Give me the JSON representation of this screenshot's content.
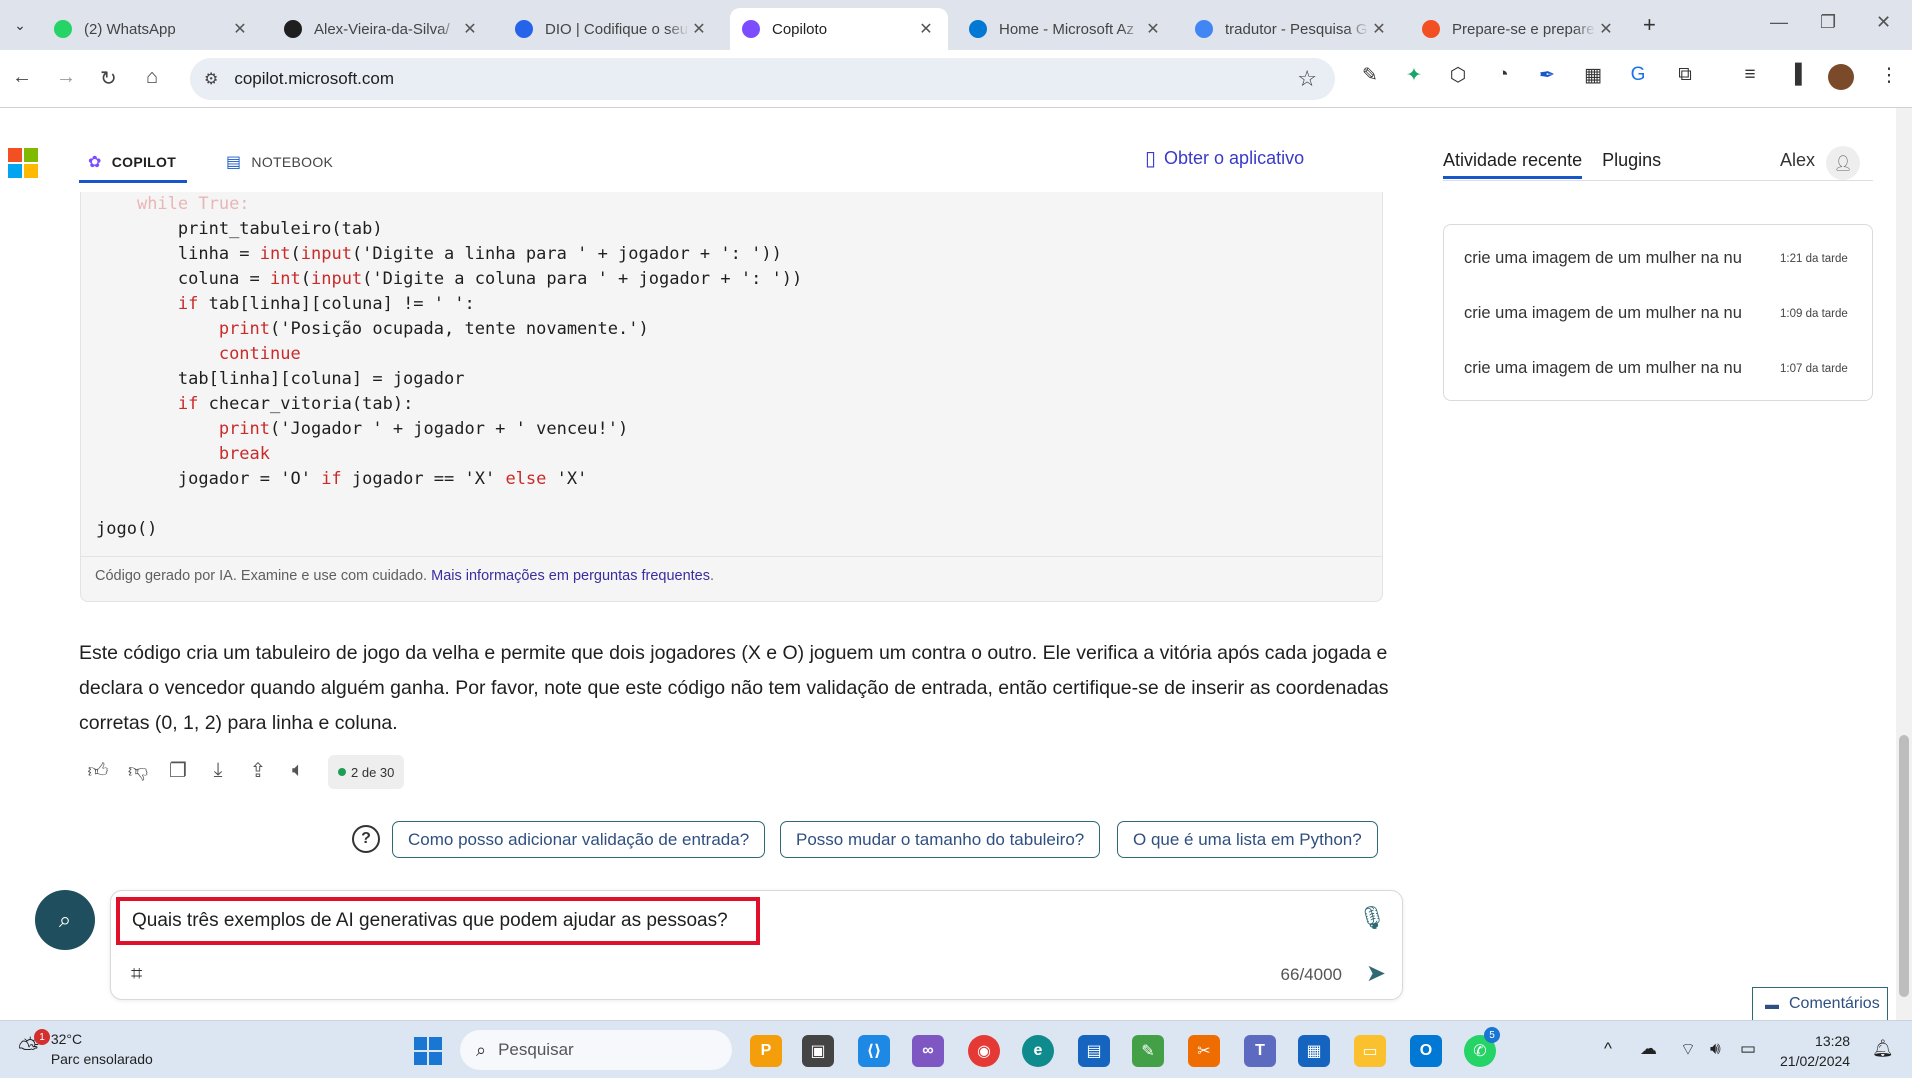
{
  "browser": {
    "tabs": [
      {
        "title": "(2) WhatsApp",
        "icon": "whatsapp-icon",
        "color": "#25d366"
      },
      {
        "title": "Alex-Vieira-da-Silva/",
        "icon": "github-icon",
        "color": "#1f1f1f"
      },
      {
        "title": "DIO | Codifique o seu",
        "icon": "dio-icon",
        "color": "#2563eb"
      },
      {
        "title": "Copiloto",
        "icon": "copilot-icon",
        "color": "#7c4dff"
      },
      {
        "title": "Home - Microsoft Az",
        "icon": "azure-icon",
        "color": "#0078d4"
      },
      {
        "title": "tradutor - Pesquisa G",
        "icon": "google-icon",
        "color": "#4285f4"
      },
      {
        "title": "Prepare-se e prepare",
        "icon": "microsoft-icon",
        "color": "#f25022"
      }
    ],
    "url": "copilot.microsoft.com"
  },
  "copilot": {
    "nav": {
      "copilot": "COPILOT",
      "notebook": "NOTEBOOK",
      "get_app": "Obter o aplicativo"
    },
    "code_lines": [
      {
        "indent": "    ",
        "parts": [
          {
            "t": "while True:",
            "c": "fade"
          }
        ]
      },
      {
        "indent": "        ",
        "parts": [
          {
            "t": "print_tabuleiro(tab)",
            "c": ""
          }
        ]
      },
      {
        "indent": "        ",
        "parts": [
          {
            "t": "linha = ",
            "c": ""
          },
          {
            "t": "int",
            "c": "fn"
          },
          {
            "t": "(",
            "c": ""
          },
          {
            "t": "input",
            "c": "fn"
          },
          {
            "t": "('Digite a linha para ' + jogador + ': '))",
            "c": ""
          }
        ]
      },
      {
        "indent": "        ",
        "parts": [
          {
            "t": "coluna = ",
            "c": ""
          },
          {
            "t": "int",
            "c": "fn"
          },
          {
            "t": "(",
            "c": ""
          },
          {
            "t": "input",
            "c": "fn"
          },
          {
            "t": "('Digite a coluna para ' + jogador + ': '))",
            "c": ""
          }
        ]
      },
      {
        "indent": "        ",
        "parts": [
          {
            "t": "if",
            "c": "kw"
          },
          {
            "t": " tab[linha][coluna] != ' ':",
            "c": ""
          }
        ]
      },
      {
        "indent": "            ",
        "parts": [
          {
            "t": "print",
            "c": "fn"
          },
          {
            "t": "('Posição ocupada, tente novamente.')",
            "c": ""
          }
        ]
      },
      {
        "indent": "            ",
        "parts": [
          {
            "t": "continue",
            "c": "kw"
          }
        ]
      },
      {
        "indent": "        ",
        "parts": [
          {
            "t": "tab[linha][coluna] = jogador",
            "c": ""
          }
        ]
      },
      {
        "indent": "        ",
        "parts": [
          {
            "t": "if",
            "c": "kw"
          },
          {
            "t": " checar_vitoria(tab):",
            "c": ""
          }
        ]
      },
      {
        "indent": "            ",
        "parts": [
          {
            "t": "print",
            "c": "fn"
          },
          {
            "t": "('Jogador ' + jogador + ' venceu!')",
            "c": ""
          }
        ]
      },
      {
        "indent": "            ",
        "parts": [
          {
            "t": "break",
            "c": "kw"
          }
        ]
      },
      {
        "indent": "        ",
        "parts": [
          {
            "t": "jogador = 'O' ",
            "c": ""
          },
          {
            "t": "if",
            "c": "kw"
          },
          {
            "t": " jogador == 'X' ",
            "c": ""
          },
          {
            "t": "else",
            "c": "kw"
          },
          {
            "t": " 'X'",
            "c": ""
          }
        ]
      },
      {
        "indent": "",
        "parts": [
          {
            "t": "",
            "c": ""
          }
        ]
      },
      {
        "indent": "",
        "parts": [
          {
            "t": "jogo()",
            "c": ""
          }
        ]
      }
    ],
    "disclaimer": "Código gerado por IA. Examine e use com cuidado.",
    "disclaimer_link": "Mais informações em perguntas frequentes",
    "explanation": "Este código cria um tabuleiro de jogo da velha e permite que dois jogadores (X e O) joguem um contra o outro. Ele verifica a vitória após cada jogada e declara o vencedor quando alguém ganha. Por favor, note que este código não tem validação de entrada, então certifique-se de inserir as coordenadas corretas (0, 1, 2) para linha e coluna.",
    "pager": "2 de 30",
    "suggestions": [
      "Como posso adicionar validação de entrada?",
      "Posso mudar o tamanho do tabuleiro?",
      "O que é uma lista em Python?"
    ],
    "input_value": "Quais três exemplos de AI generativas que podem ajudar as pessoas?",
    "counter": "66/4000",
    "comments": "Comentários"
  },
  "sidebar": {
    "tabs": [
      "Atividade recente",
      "Plugins"
    ],
    "user": "Alex",
    "recent": [
      {
        "text": "crie uma imagem de um mulher na nu",
        "time": "1:21 da tarde"
      },
      {
        "text": "crie uma imagem de um mulher na nu",
        "time": "1:09 da tarde"
      },
      {
        "text": "crie uma imagem de um mulher na nu",
        "time": "1:07 da tarde"
      }
    ]
  },
  "taskbar": {
    "weather_temp": "32°C",
    "weather_desc": "Parc ensolarado",
    "weather_badge": "1",
    "search": "Pesquisar",
    "whatsapp_badge": "5",
    "time": "13:28",
    "date": "21/02/2024"
  }
}
